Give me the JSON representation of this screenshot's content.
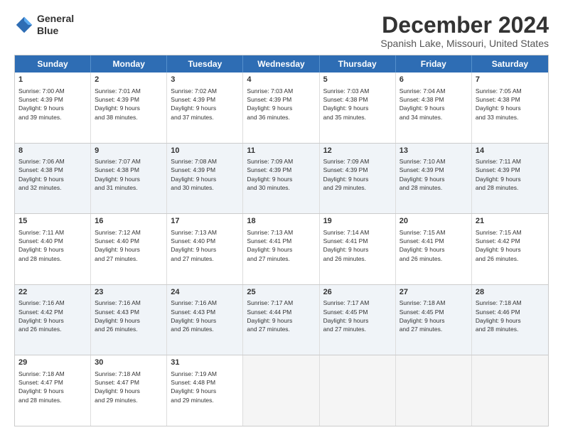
{
  "header": {
    "logo_line1": "General",
    "logo_line2": "Blue",
    "month": "December 2024",
    "location": "Spanish Lake, Missouri, United States"
  },
  "weekdays": [
    "Sunday",
    "Monday",
    "Tuesday",
    "Wednesday",
    "Thursday",
    "Friday",
    "Saturday"
  ],
  "rows": [
    [
      {
        "day": "1",
        "lines": [
          "Sunrise: 7:00 AM",
          "Sunset: 4:39 PM",
          "Daylight: 9 hours",
          "and 39 minutes."
        ]
      },
      {
        "day": "2",
        "lines": [
          "Sunrise: 7:01 AM",
          "Sunset: 4:39 PM",
          "Daylight: 9 hours",
          "and 38 minutes."
        ]
      },
      {
        "day": "3",
        "lines": [
          "Sunrise: 7:02 AM",
          "Sunset: 4:39 PM",
          "Daylight: 9 hours",
          "and 37 minutes."
        ]
      },
      {
        "day": "4",
        "lines": [
          "Sunrise: 7:03 AM",
          "Sunset: 4:39 PM",
          "Daylight: 9 hours",
          "and 36 minutes."
        ]
      },
      {
        "day": "5",
        "lines": [
          "Sunrise: 7:03 AM",
          "Sunset: 4:38 PM",
          "Daylight: 9 hours",
          "and 35 minutes."
        ]
      },
      {
        "day": "6",
        "lines": [
          "Sunrise: 7:04 AM",
          "Sunset: 4:38 PM",
          "Daylight: 9 hours",
          "and 34 minutes."
        ]
      },
      {
        "day": "7",
        "lines": [
          "Sunrise: 7:05 AM",
          "Sunset: 4:38 PM",
          "Daylight: 9 hours",
          "and 33 minutes."
        ]
      }
    ],
    [
      {
        "day": "8",
        "lines": [
          "Sunrise: 7:06 AM",
          "Sunset: 4:38 PM",
          "Daylight: 9 hours",
          "and 32 minutes."
        ]
      },
      {
        "day": "9",
        "lines": [
          "Sunrise: 7:07 AM",
          "Sunset: 4:38 PM",
          "Daylight: 9 hours",
          "and 31 minutes."
        ]
      },
      {
        "day": "10",
        "lines": [
          "Sunrise: 7:08 AM",
          "Sunset: 4:39 PM",
          "Daylight: 9 hours",
          "and 30 minutes."
        ]
      },
      {
        "day": "11",
        "lines": [
          "Sunrise: 7:09 AM",
          "Sunset: 4:39 PM",
          "Daylight: 9 hours",
          "and 30 minutes."
        ]
      },
      {
        "day": "12",
        "lines": [
          "Sunrise: 7:09 AM",
          "Sunset: 4:39 PM",
          "Daylight: 9 hours",
          "and 29 minutes."
        ]
      },
      {
        "day": "13",
        "lines": [
          "Sunrise: 7:10 AM",
          "Sunset: 4:39 PM",
          "Daylight: 9 hours",
          "and 28 minutes."
        ]
      },
      {
        "day": "14",
        "lines": [
          "Sunrise: 7:11 AM",
          "Sunset: 4:39 PM",
          "Daylight: 9 hours",
          "and 28 minutes."
        ]
      }
    ],
    [
      {
        "day": "15",
        "lines": [
          "Sunrise: 7:11 AM",
          "Sunset: 4:40 PM",
          "Daylight: 9 hours",
          "and 28 minutes."
        ]
      },
      {
        "day": "16",
        "lines": [
          "Sunrise: 7:12 AM",
          "Sunset: 4:40 PM",
          "Daylight: 9 hours",
          "and 27 minutes."
        ]
      },
      {
        "day": "17",
        "lines": [
          "Sunrise: 7:13 AM",
          "Sunset: 4:40 PM",
          "Daylight: 9 hours",
          "and 27 minutes."
        ]
      },
      {
        "day": "18",
        "lines": [
          "Sunrise: 7:13 AM",
          "Sunset: 4:41 PM",
          "Daylight: 9 hours",
          "and 27 minutes."
        ]
      },
      {
        "day": "19",
        "lines": [
          "Sunrise: 7:14 AM",
          "Sunset: 4:41 PM",
          "Daylight: 9 hours",
          "and 26 minutes."
        ]
      },
      {
        "day": "20",
        "lines": [
          "Sunrise: 7:15 AM",
          "Sunset: 4:41 PM",
          "Daylight: 9 hours",
          "and 26 minutes."
        ]
      },
      {
        "day": "21",
        "lines": [
          "Sunrise: 7:15 AM",
          "Sunset: 4:42 PM",
          "Daylight: 9 hours",
          "and 26 minutes."
        ]
      }
    ],
    [
      {
        "day": "22",
        "lines": [
          "Sunrise: 7:16 AM",
          "Sunset: 4:42 PM",
          "Daylight: 9 hours",
          "and 26 minutes."
        ]
      },
      {
        "day": "23",
        "lines": [
          "Sunrise: 7:16 AM",
          "Sunset: 4:43 PM",
          "Daylight: 9 hours",
          "and 26 minutes."
        ]
      },
      {
        "day": "24",
        "lines": [
          "Sunrise: 7:16 AM",
          "Sunset: 4:43 PM",
          "Daylight: 9 hours",
          "and 26 minutes."
        ]
      },
      {
        "day": "25",
        "lines": [
          "Sunrise: 7:17 AM",
          "Sunset: 4:44 PM",
          "Daylight: 9 hours",
          "and 27 minutes."
        ]
      },
      {
        "day": "26",
        "lines": [
          "Sunrise: 7:17 AM",
          "Sunset: 4:45 PM",
          "Daylight: 9 hours",
          "and 27 minutes."
        ]
      },
      {
        "day": "27",
        "lines": [
          "Sunrise: 7:18 AM",
          "Sunset: 4:45 PM",
          "Daylight: 9 hours",
          "and 27 minutes."
        ]
      },
      {
        "day": "28",
        "lines": [
          "Sunrise: 7:18 AM",
          "Sunset: 4:46 PM",
          "Daylight: 9 hours",
          "and 28 minutes."
        ]
      }
    ],
    [
      {
        "day": "29",
        "lines": [
          "Sunrise: 7:18 AM",
          "Sunset: 4:47 PM",
          "Daylight: 9 hours",
          "and 28 minutes."
        ]
      },
      {
        "day": "30",
        "lines": [
          "Sunrise: 7:18 AM",
          "Sunset: 4:47 PM",
          "Daylight: 9 hours",
          "and 29 minutes."
        ]
      },
      {
        "day": "31",
        "lines": [
          "Sunrise: 7:19 AM",
          "Sunset: 4:48 PM",
          "Daylight: 9 hours",
          "and 29 minutes."
        ]
      },
      null,
      null,
      null,
      null
    ]
  ]
}
